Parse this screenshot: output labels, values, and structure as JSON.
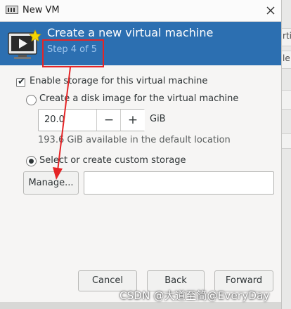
{
  "window": {
    "title": "New VM",
    "close_icon": "close-icon"
  },
  "header": {
    "title": "Create a new virtual machine",
    "step": "Step 4 of 5",
    "icon": "virtual-machine-icon"
  },
  "storage": {
    "enable_label": "Enable storage for this virtual machine",
    "enable_checked": true,
    "create_disk_label": "Create a disk image for the virtual machine",
    "create_disk_selected": false,
    "disk_size_value": "20.0",
    "disk_size_minus": "−",
    "disk_size_plus": "+",
    "disk_size_unit": "GiB",
    "available_text": "193.6 GiB available in the default location",
    "custom_label": "Select or create custom storage",
    "custom_selected": true,
    "manage_label": "Manage...",
    "path_value": ""
  },
  "buttons": {
    "cancel": "Cancel",
    "back": "Back",
    "forward": "Forward"
  },
  "background_window": {
    "fragments": [
      "rti",
      "le"
    ]
  },
  "annotation": {
    "color": "#e52426"
  },
  "watermark": "CSDN @大道至简@EveryDay",
  "colors": {
    "header_bg": "#2c6fb1",
    "header_title": "#ffffff",
    "header_step": "#9cc4ec"
  }
}
